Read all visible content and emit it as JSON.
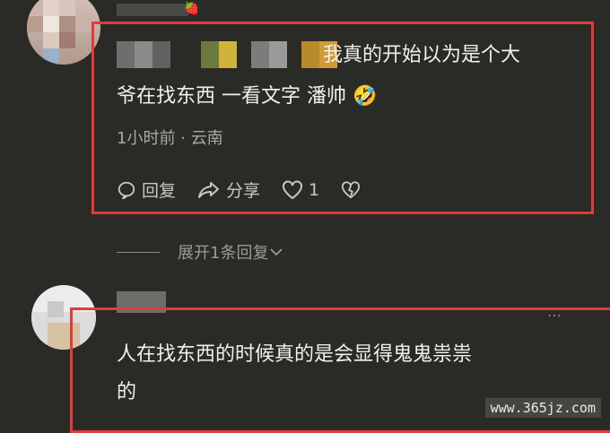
{
  "comment1": {
    "text_line1": "我真的开始以为是个大",
    "text_line2": "爷在找东西 一看文字 潘帅",
    "emoji": "🤣",
    "time": "1小时前 · 云南",
    "reply_label": "回复",
    "share_label": "分享",
    "like_count": "1"
  },
  "expand_replies": "展开1条回复",
  "comment2": {
    "text_line1": "人在找东西的时候真的是会显得鬼鬼祟祟",
    "text_line2": "的"
  },
  "watermark": "www.365jz.com",
  "colors": {
    "highlight": "#e23b3b",
    "background": "#2a2a26"
  }
}
